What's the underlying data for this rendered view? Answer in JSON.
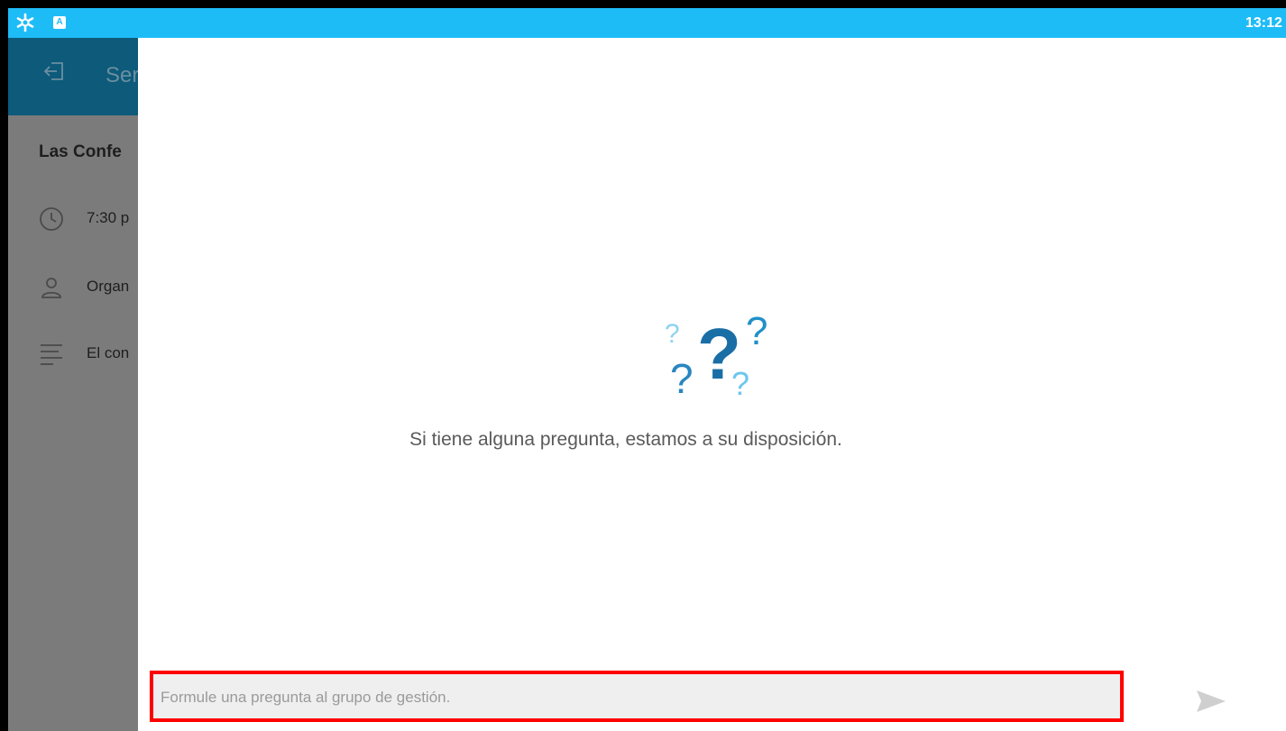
{
  "status_bar": {
    "time": "13:12",
    "left_icons": [
      "asterisk-icon",
      "a-badge-icon"
    ],
    "a_badge_label": "A",
    "color": "#1ebcf7"
  },
  "background_screen": {
    "appbar_title": "Ser",
    "event_title": "Las Confe",
    "time_text": "7:30 p",
    "organizer_text": "Organ",
    "description_text": "El con"
  },
  "chat": {
    "empty_message": "Si tiene alguna pregunta, estamos a su disposición.",
    "input_placeholder": "Formule una pregunta al grupo de gestión.",
    "input_value": "",
    "send_icon": "send-icon",
    "illustration_icon": "question-marks-icon"
  }
}
